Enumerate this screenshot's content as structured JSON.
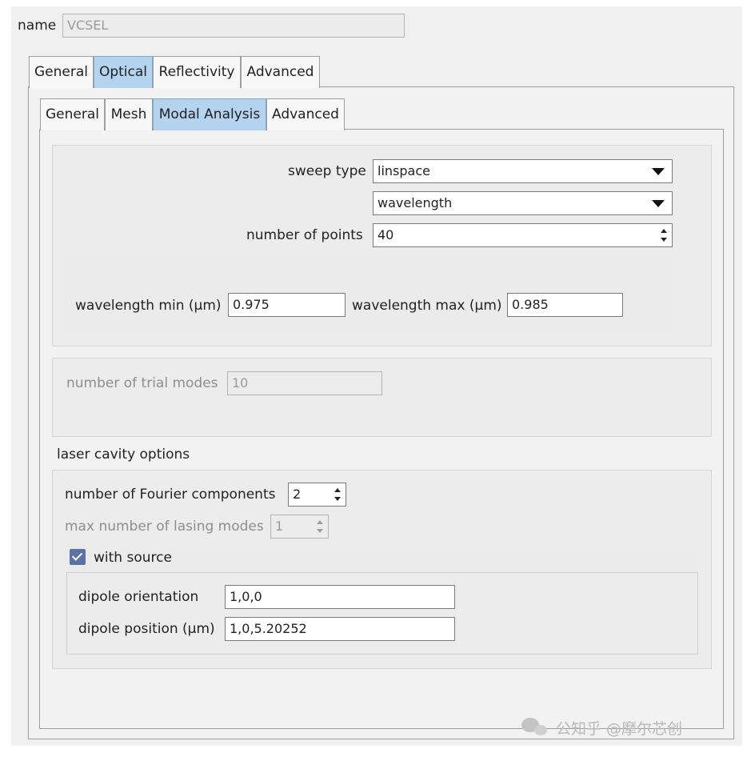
{
  "header": {
    "name_label": "name",
    "name_value": "VCSEL"
  },
  "outer_tabs": [
    {
      "label": "General"
    },
    {
      "label": "Optical",
      "active": true
    },
    {
      "label": "Reflectivity"
    },
    {
      "label": "Advanced"
    }
  ],
  "inner_tabs": [
    {
      "label": "General"
    },
    {
      "label": "Mesh"
    },
    {
      "label": "Modal Analysis",
      "active": true
    },
    {
      "label": "Advanced"
    }
  ],
  "sweep": {
    "type_label": "sweep type",
    "type_value": "linspace",
    "variable_value": "wavelength",
    "points_label": "number of points",
    "points_value": "40",
    "wl_min_label": "wavelength min (µm)",
    "wl_min_value": "0.975",
    "wl_max_label": "wavelength max (µm)",
    "wl_max_value": "0.985"
  },
  "trial": {
    "label": "number of trial modes",
    "value": "10",
    "enabled": false
  },
  "laser": {
    "section_label": "laser cavity options",
    "fourier_label": "number of Fourier components",
    "fourier_value": "2",
    "lasing_label": "max number of lasing modes",
    "lasing_value": "1",
    "lasing_enabled": false,
    "with_source_label": "with source",
    "with_source_checked": true,
    "dipole_orientation_label": "dipole orientation",
    "dipole_orientation_value": "1,0,0",
    "dipole_position_label": "dipole position (µm)",
    "dipole_position_value": "1,0,5.20252"
  },
  "watermark": {
    "text": "公知乎 @摩尔芯创",
    "icon": "wechat-icon"
  },
  "colors": {
    "active_tab": "#b3d3ef",
    "checkbox": "#5b72a6",
    "window_bg": "#f0f0f0",
    "disabled_text": "#8d8d8d"
  }
}
